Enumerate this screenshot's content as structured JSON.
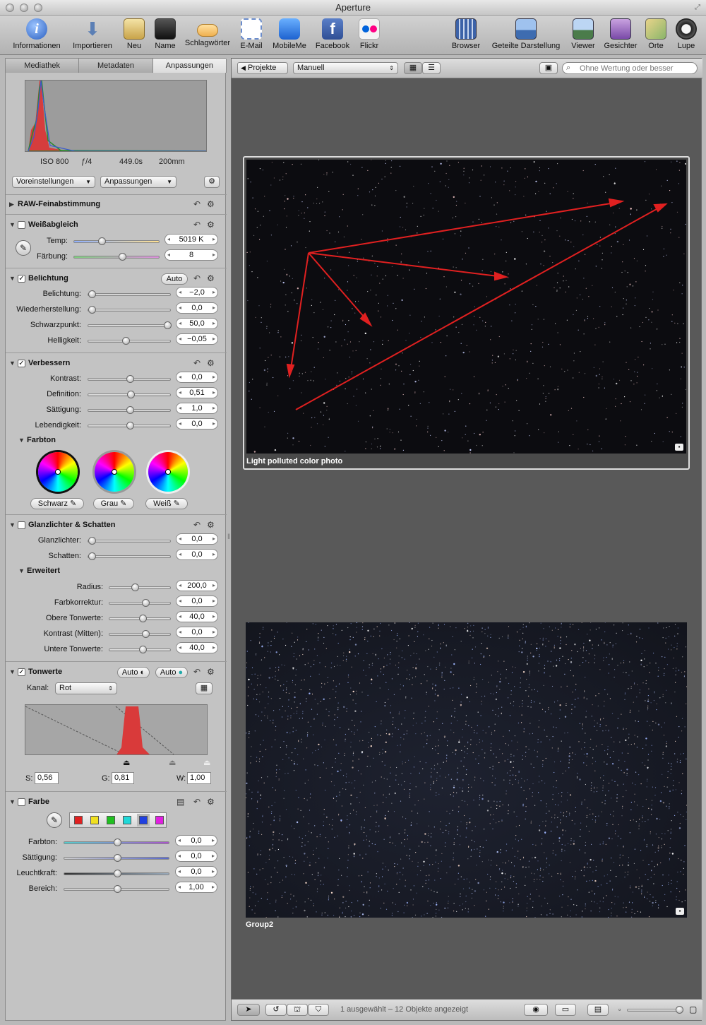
{
  "window": {
    "title": "Aperture"
  },
  "toolbar": {
    "items": [
      {
        "label": "Informationen",
        "icon": "info-icon"
      },
      {
        "label": "Importieren",
        "icon": "import-arrow-icon"
      },
      {
        "label": "Neu",
        "icon": "new-project-icon"
      },
      {
        "label": "Name",
        "icon": "name-person-icon"
      },
      {
        "label": "Schlagwörter",
        "icon": "keywords-tag-icon"
      },
      {
        "label": "E-Mail",
        "icon": "email-stamp-icon"
      },
      {
        "label": "MobileMe",
        "icon": "mobileme-cloud-icon"
      },
      {
        "label": "Facebook",
        "icon": "facebook-icon"
      },
      {
        "label": "Flickr",
        "icon": "flickr-icon"
      },
      {
        "label": "Browser",
        "icon": "browser-grid-icon"
      },
      {
        "label": "Geteilte Darstellung",
        "icon": "split-view-icon"
      },
      {
        "label": "Viewer",
        "icon": "viewer-icon"
      },
      {
        "label": "Gesichter",
        "icon": "faces-icon"
      },
      {
        "label": "Orte",
        "icon": "places-map-icon"
      },
      {
        "label": "Lupe",
        "icon": "loupe-icon"
      }
    ]
  },
  "inspector": {
    "tabs": [
      "Mediathek",
      "Metadaten",
      "Anpassungen"
    ],
    "histogram_info": {
      "iso": "ISO 800",
      "aperture": "ƒ/4",
      "shutter": "449.0s",
      "focal": "200mm"
    },
    "presets_label": "Voreinstellungen",
    "adjustments_label": "Anpassungen",
    "raw": {
      "title": "RAW-Feinabstimmung"
    },
    "white_balance": {
      "title": "Weißabgleich",
      "temp_label": "Temp:",
      "temp_value": "5019 K",
      "tint_label": "Färbung:",
      "tint_value": "8"
    },
    "exposure": {
      "title": "Belichtung",
      "auto": "Auto",
      "rows": [
        {
          "label": "Belichtung:",
          "value": "−2,0",
          "level": 0.0
        },
        {
          "label": "Wiederherstellung:",
          "value": "0,0",
          "level": 0.0
        },
        {
          "label": "Schwarzpunkt:",
          "value": "50,0",
          "level": 1.0
        },
        {
          "label": "Helligkeit:",
          "value": "−0,05",
          "level": 0.45
        }
      ]
    },
    "enhance": {
      "title": "Verbessern",
      "rows": [
        {
          "label": "Kontrast:",
          "value": "0,0",
          "level": 0.5
        },
        {
          "label": "Definition:",
          "value": "0,51",
          "level": 0.51
        },
        {
          "label": "Sättigung:",
          "value": "1,0",
          "level": 0.5
        },
        {
          "label": "Lebendigkeit:",
          "value": "0,0",
          "level": 0.5
        }
      ],
      "tint_title": "Farbton",
      "wheels": [
        "Schwarz",
        "Grau",
        "Weiß"
      ]
    },
    "highlights": {
      "title": "Glanzlichter & Schatten",
      "rows": [
        {
          "label": "Glanzlichter:",
          "value": "0,0",
          "level": 0.0
        },
        {
          "label": "Schatten:",
          "value": "0,0",
          "level": 0.0
        }
      ],
      "advanced_title": "Erweitert",
      "adv_rows": [
        {
          "label": "Radius:",
          "value": "200,0",
          "level": 0.4
        },
        {
          "label": "Farbkorrektur:",
          "value": "0,0",
          "level": 0.6
        },
        {
          "label": "Obere Tonwerte:",
          "value": "40,0",
          "level": 0.55
        },
        {
          "label": "Kontrast (Mitten):",
          "value": "0,0",
          "level": 0.6
        },
        {
          "label": "Untere Tonwerte:",
          "value": "40,0",
          "level": 0.55
        }
      ]
    },
    "levels": {
      "title": "Tonwerte",
      "auto1": "Auto",
      "auto2": "Auto",
      "channel_label": "Kanal:",
      "channel_value": "Rot",
      "s_label": "S:",
      "s_value": "0,56",
      "g_label": "G:",
      "g_value": "0,81",
      "w_label": "W:",
      "w_value": "1,00"
    },
    "color": {
      "title": "Farbe",
      "swatches": [
        "#e02020",
        "#f0e020",
        "#20c020",
        "#20d8d8",
        "#2040e0",
        "#e020e0"
      ],
      "rows": [
        {
          "label": "Farbton:",
          "value": "0,0",
          "level": 0.5
        },
        {
          "label": "Sättigung:",
          "value": "0,0",
          "level": 0.5
        },
        {
          "label": "Leuchtkraft:",
          "value": "0,0",
          "level": 0.5
        },
        {
          "label": "Bereich:",
          "value": "1,00",
          "level": 0.5
        }
      ]
    }
  },
  "browser": {
    "projects_button": "Projekte",
    "sort_value": "Manuell",
    "filter_placeholder": "Ohne Wertung oder besser",
    "photos": [
      {
        "caption": "Light polluted color photo"
      },
      {
        "caption": "Group2"
      }
    ],
    "status": "1 ausgewählt – 12 Objekte angezeigt"
  }
}
